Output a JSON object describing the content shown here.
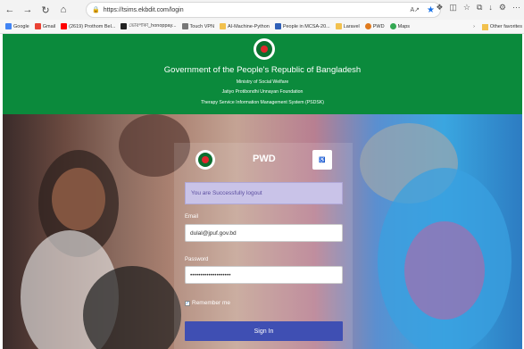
{
  "browser": {
    "url": "https://tsims.ekbdit.com/login",
    "bookmarks": [
      {
        "label": "Google",
        "color": "#4285f4"
      },
      {
        "label": "Gmail",
        "color": "#ea4335"
      },
      {
        "label": "(2619) Prothom Bel...",
        "color": "#ff0000"
      },
      {
        "label": "ভোরপাকা_honoppay...",
        "color": "#222222"
      },
      {
        "label": "Touch VPN",
        "color": "#777777"
      },
      {
        "label": "AI-Machine-Python",
        "color": "#f2c14e"
      },
      {
        "label": "People in MCSA-20...",
        "color": "#2f5fb7"
      },
      {
        "label": "Laravel",
        "color": "#f2c14e"
      },
      {
        "label": "PWD",
        "color": "#e07a1e"
      },
      {
        "label": "Maps",
        "color": "#34a853"
      }
    ],
    "other_favorites": "Other favorites"
  },
  "header": {
    "title": "Government of the People's Republic of Bangladesh",
    "line1": "Ministry of Social Welfare",
    "line2": "Jatiyo Protibondhi Unnayan Foundation",
    "line3": "Therapy Service Information Management System (PSDSK)"
  },
  "login": {
    "brand": "PWD",
    "alert": "You are Successfully logout",
    "email_label": "Email",
    "email_value": "dulal@jpuf.gov.bd",
    "password_label": "Password",
    "password_value": "••••••••••••••••••••",
    "remember_label": "Remember me",
    "signin_label": "Sign In"
  }
}
